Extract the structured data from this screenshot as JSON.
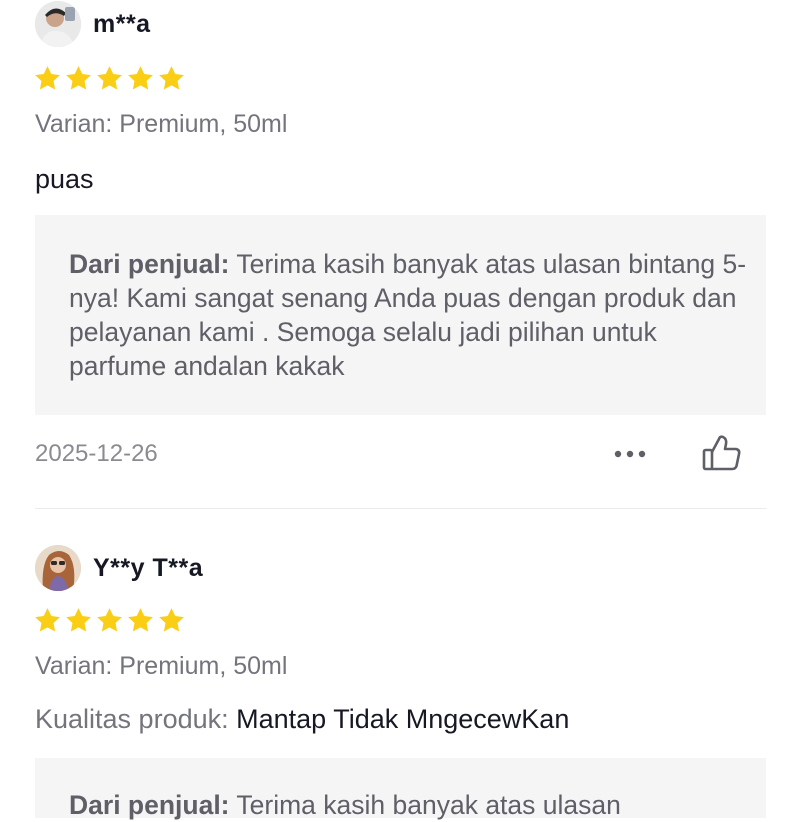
{
  "reviews": [
    {
      "username": "m**a",
      "rating": 5,
      "variant": "Varian: Premium, 50ml",
      "comment_prefix": "",
      "comment": "puas",
      "seller_label": "Dari penjual:",
      "seller_reply": "Terima kasih banyak atas ulasan bintang 5-nya! Kami sangat senang Anda puas dengan produk dan pelayanan kami . Semoga selalu jadi pilihan untuk parfume andalan kakak",
      "date": "2025-12-26",
      "more_icon": "more-dots-icon",
      "like_icon": "thumbs-up-icon"
    },
    {
      "username": "Y**y T**a",
      "rating": 5,
      "variant": "Varian: Premium, 50ml",
      "comment_prefix": "Kualitas produk:",
      "comment": "Mantap Tidak MngecewKan",
      "seller_label": "Dari penjual:",
      "seller_reply": "Terima kasih banyak atas ulasan"
    }
  ],
  "colors": {
    "star": "#FACE15",
    "seller_bg": "#F5F5F6",
    "muted_text": "#73747C"
  }
}
